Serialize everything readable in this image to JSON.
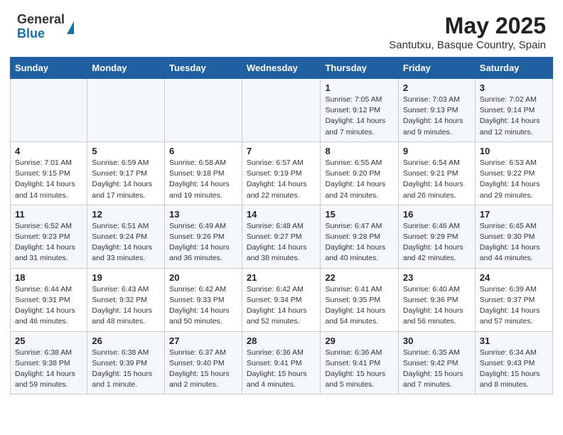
{
  "header": {
    "logo_general": "General",
    "logo_blue": "Blue",
    "title": "May 2025",
    "location": "Santutxu, Basque Country, Spain"
  },
  "weekdays": [
    "Sunday",
    "Monday",
    "Tuesday",
    "Wednesday",
    "Thursday",
    "Friday",
    "Saturday"
  ],
  "weeks": [
    [
      {
        "day": "",
        "info": ""
      },
      {
        "day": "",
        "info": ""
      },
      {
        "day": "",
        "info": ""
      },
      {
        "day": "",
        "info": ""
      },
      {
        "day": "1",
        "info": "Sunrise: 7:05 AM\nSunset: 9:12 PM\nDaylight: 14 hours\nand 7 minutes."
      },
      {
        "day": "2",
        "info": "Sunrise: 7:03 AM\nSunset: 9:13 PM\nDaylight: 14 hours\nand 9 minutes."
      },
      {
        "day": "3",
        "info": "Sunrise: 7:02 AM\nSunset: 9:14 PM\nDaylight: 14 hours\nand 12 minutes."
      }
    ],
    [
      {
        "day": "4",
        "info": "Sunrise: 7:01 AM\nSunset: 9:15 PM\nDaylight: 14 hours\nand 14 minutes."
      },
      {
        "day": "5",
        "info": "Sunrise: 6:59 AM\nSunset: 9:17 PM\nDaylight: 14 hours\nand 17 minutes."
      },
      {
        "day": "6",
        "info": "Sunrise: 6:58 AM\nSunset: 9:18 PM\nDaylight: 14 hours\nand 19 minutes."
      },
      {
        "day": "7",
        "info": "Sunrise: 6:57 AM\nSunset: 9:19 PM\nDaylight: 14 hours\nand 22 minutes."
      },
      {
        "day": "8",
        "info": "Sunrise: 6:55 AM\nSunset: 9:20 PM\nDaylight: 14 hours\nand 24 minutes."
      },
      {
        "day": "9",
        "info": "Sunrise: 6:54 AM\nSunset: 9:21 PM\nDaylight: 14 hours\nand 26 minutes."
      },
      {
        "day": "10",
        "info": "Sunrise: 6:53 AM\nSunset: 9:22 PM\nDaylight: 14 hours\nand 29 minutes."
      }
    ],
    [
      {
        "day": "11",
        "info": "Sunrise: 6:52 AM\nSunset: 9:23 PM\nDaylight: 14 hours\nand 31 minutes."
      },
      {
        "day": "12",
        "info": "Sunrise: 6:51 AM\nSunset: 9:24 PM\nDaylight: 14 hours\nand 33 minutes."
      },
      {
        "day": "13",
        "info": "Sunrise: 6:49 AM\nSunset: 9:26 PM\nDaylight: 14 hours\nand 36 minutes."
      },
      {
        "day": "14",
        "info": "Sunrise: 6:48 AM\nSunset: 9:27 PM\nDaylight: 14 hours\nand 38 minutes."
      },
      {
        "day": "15",
        "info": "Sunrise: 6:47 AM\nSunset: 9:28 PM\nDaylight: 14 hours\nand 40 minutes."
      },
      {
        "day": "16",
        "info": "Sunrise: 6:46 AM\nSunset: 9:29 PM\nDaylight: 14 hours\nand 42 minutes."
      },
      {
        "day": "17",
        "info": "Sunrise: 6:45 AM\nSunset: 9:30 PM\nDaylight: 14 hours\nand 44 minutes."
      }
    ],
    [
      {
        "day": "18",
        "info": "Sunrise: 6:44 AM\nSunset: 9:31 PM\nDaylight: 14 hours\nand 46 minutes."
      },
      {
        "day": "19",
        "info": "Sunrise: 6:43 AM\nSunset: 9:32 PM\nDaylight: 14 hours\nand 48 minutes."
      },
      {
        "day": "20",
        "info": "Sunrise: 6:42 AM\nSunset: 9:33 PM\nDaylight: 14 hours\nand 50 minutes."
      },
      {
        "day": "21",
        "info": "Sunrise: 6:42 AM\nSunset: 9:34 PM\nDaylight: 14 hours\nand 52 minutes."
      },
      {
        "day": "22",
        "info": "Sunrise: 6:41 AM\nSunset: 9:35 PM\nDaylight: 14 hours\nand 54 minutes."
      },
      {
        "day": "23",
        "info": "Sunrise: 6:40 AM\nSunset: 9:36 PM\nDaylight: 14 hours\nand 56 minutes."
      },
      {
        "day": "24",
        "info": "Sunrise: 6:39 AM\nSunset: 9:37 PM\nDaylight: 14 hours\nand 57 minutes."
      }
    ],
    [
      {
        "day": "25",
        "info": "Sunrise: 6:38 AM\nSunset: 9:38 PM\nDaylight: 14 hours\nand 59 minutes."
      },
      {
        "day": "26",
        "info": "Sunrise: 6:38 AM\nSunset: 9:39 PM\nDaylight: 15 hours\nand 1 minute."
      },
      {
        "day": "27",
        "info": "Sunrise: 6:37 AM\nSunset: 9:40 PM\nDaylight: 15 hours\nand 2 minutes."
      },
      {
        "day": "28",
        "info": "Sunrise: 6:36 AM\nSunset: 9:41 PM\nDaylight: 15 hours\nand 4 minutes."
      },
      {
        "day": "29",
        "info": "Sunrise: 6:36 AM\nSunset: 9:41 PM\nDaylight: 15 hours\nand 5 minutes."
      },
      {
        "day": "30",
        "info": "Sunrise: 6:35 AM\nSunset: 9:42 PM\nDaylight: 15 hours\nand 7 minutes."
      },
      {
        "day": "31",
        "info": "Sunrise: 6:34 AM\nSunset: 9:43 PM\nDaylight: 15 hours\nand 8 minutes."
      }
    ]
  ]
}
